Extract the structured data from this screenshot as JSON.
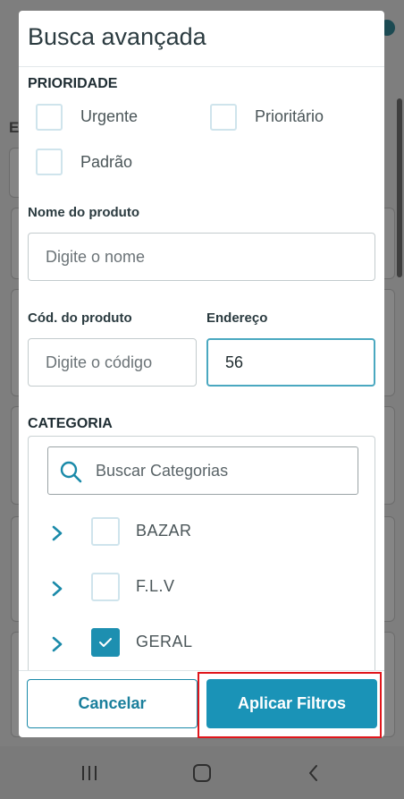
{
  "modal": {
    "title": "Busca avançada",
    "priority": {
      "label": "PRIORIDADE",
      "options": [
        {
          "label": "Urgente",
          "checked": false
        },
        {
          "label": "Prioritário",
          "checked": false
        },
        {
          "label": "Padrão",
          "checked": false
        }
      ]
    },
    "product_name": {
      "label": "Nome do produto",
      "placeholder": "Digite o nome",
      "value": ""
    },
    "product_code": {
      "label": "Cód. do produto",
      "placeholder": "Digite o código",
      "value": ""
    },
    "address": {
      "label": "Endereço",
      "placeholder": "",
      "value": "56"
    },
    "category": {
      "label": "CATEGORIA",
      "search_placeholder": "Buscar Categorias",
      "items": [
        {
          "label": "BAZAR",
          "checked": false
        },
        {
          "label": "F.L.V",
          "checked": false
        },
        {
          "label": "GERAL",
          "checked": true
        }
      ]
    },
    "buttons": {
      "cancel": "Cancelar",
      "apply": "Aplicar Filtros"
    }
  },
  "colors": {
    "accent": "#1a93b7",
    "checkbox_border": "#cfe4ec",
    "highlight": "#e0161c"
  },
  "icons": {
    "search": "search-icon",
    "chevron": "chevron-right-icon",
    "check": "check-icon",
    "nav_recents": "recents-icon",
    "nav_home": "home-icon",
    "nav_back": "back-icon"
  }
}
